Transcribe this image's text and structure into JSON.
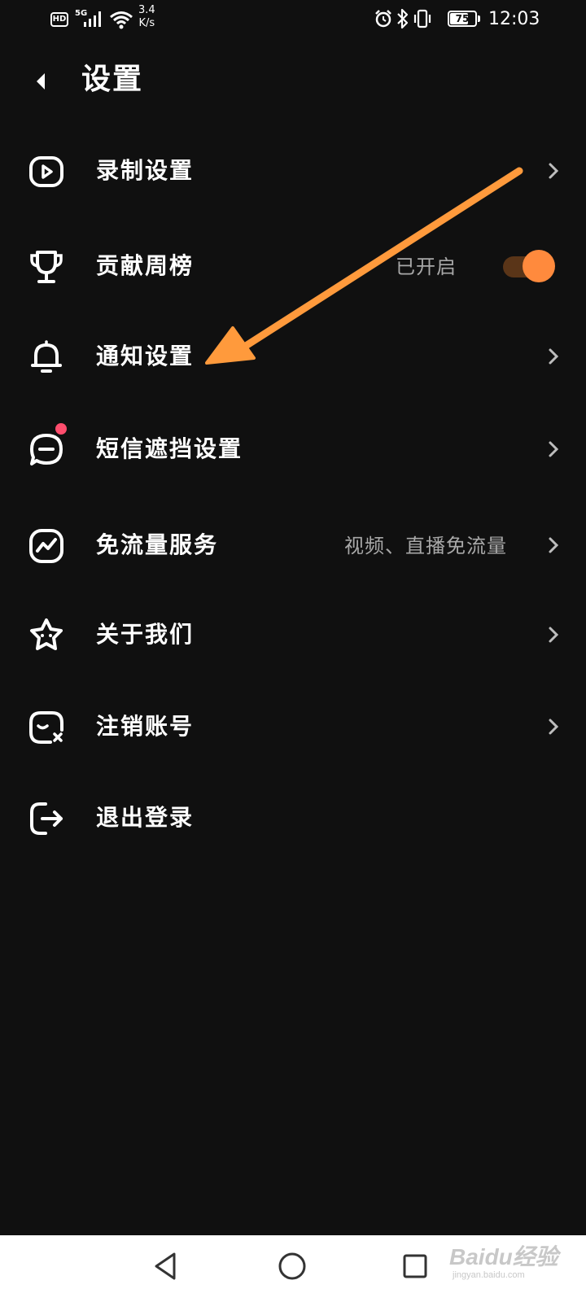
{
  "status_bar": {
    "hd": "HD",
    "network": "5G",
    "speed_value": "3.4",
    "speed_unit": "K/s",
    "battery": "75",
    "battery_level": 0.75,
    "time": "12:03",
    "icons": [
      "hd-icon",
      "signal-icon",
      "wifi-icon",
      "alarm-icon",
      "bluetooth-icon",
      "vibrate-icon",
      "battery-icon"
    ]
  },
  "header": {
    "back_icon": "back-arrow-icon",
    "title": "设置"
  },
  "settings": {
    "record": {
      "label": "录制设置",
      "icon": "video-icon"
    },
    "contribution": {
      "label": "贡献周榜",
      "icon": "trophy-icon",
      "value": "已开启",
      "toggle_on": true
    },
    "notification": {
      "label": "通知设置",
      "icon": "bell-icon"
    },
    "sms_block": {
      "label": "短信遮挡设置",
      "icon": "message-icon",
      "has_badge": true
    },
    "free_data": {
      "label": "免流量服务",
      "icon": "chart-icon",
      "value": "视频、直播免流量"
    },
    "about": {
      "label": "关于我们",
      "icon": "star-icon"
    },
    "deactivate": {
      "label": "注销账号",
      "icon": "account-cancel-icon"
    },
    "logout": {
      "label": "退出登录",
      "icon": "logout-icon"
    }
  },
  "colors": {
    "background": "#101010",
    "accent": "#ff8a3d",
    "secondary_text": "#a8a8a8",
    "badge": "#ff4d6d"
  },
  "nav_bar": {
    "icons": [
      "nav-back-icon",
      "nav-home-icon",
      "nav-recent-icon"
    ]
  },
  "watermark": {
    "main": "Baidu经验",
    "sub": "jingyan.baidu.com"
  }
}
